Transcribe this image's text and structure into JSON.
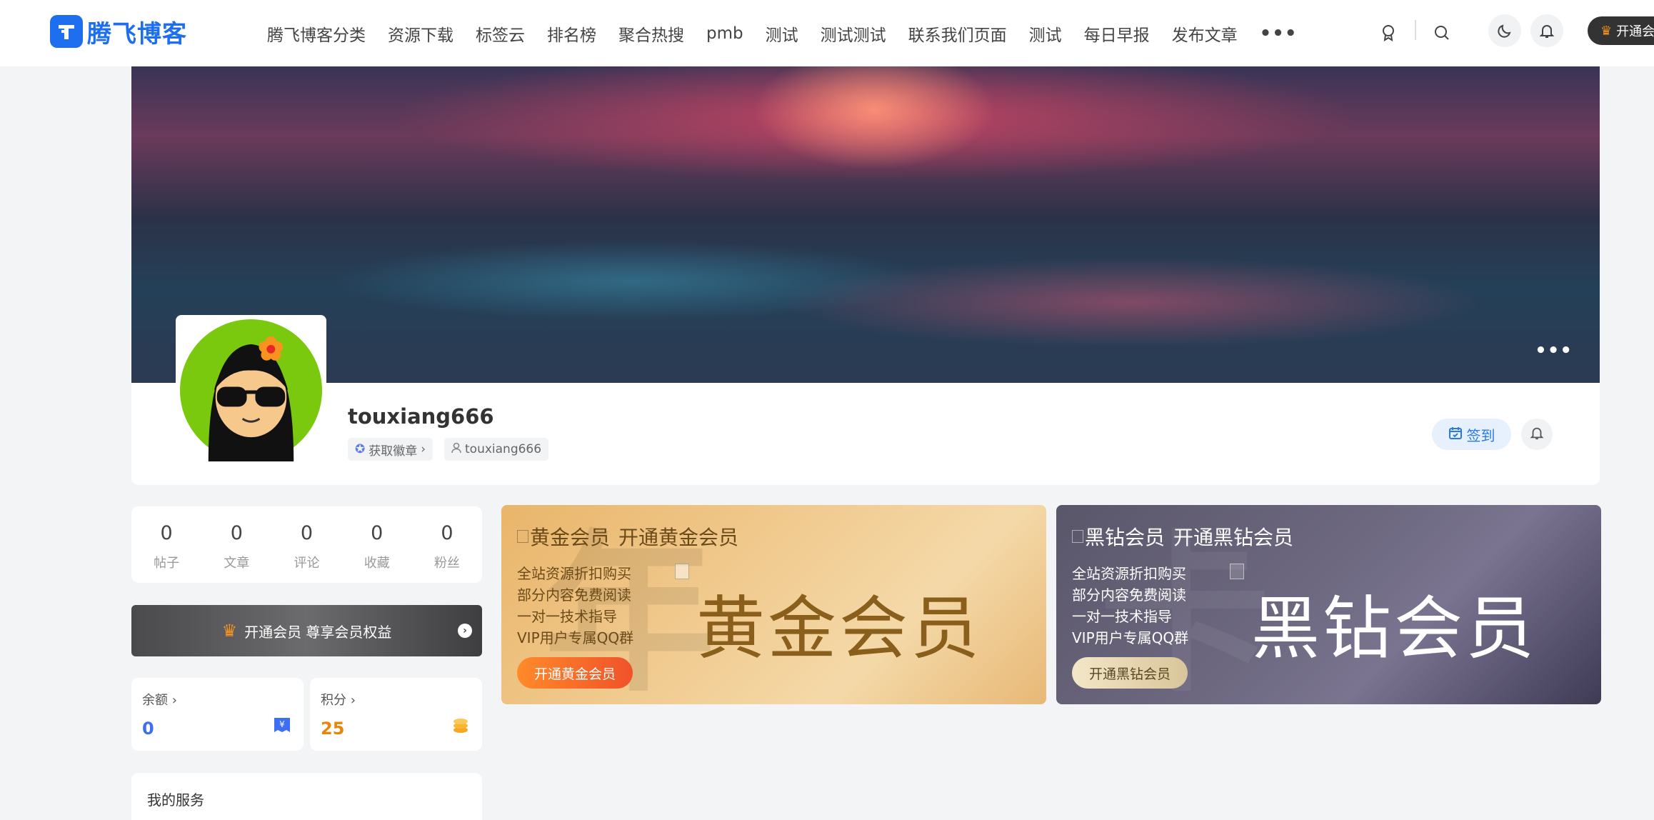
{
  "header": {
    "logo_text": "腾飞博客",
    "nav": [
      "腾飞博客分类",
      "资源下载",
      "标签云",
      "排名榜",
      "聚合热搜",
      "pmb",
      "测试",
      "测试测试",
      "联系我们页面",
      "测试",
      "每日早报",
      "发布文章"
    ],
    "more": "•••",
    "vip_button": "开通会",
    "icons": [
      "medal-icon",
      "search-icon",
      "moon-icon",
      "bell-icon",
      "crown-icon"
    ]
  },
  "cover": {
    "more": "•••"
  },
  "profile": {
    "username": "touxiang666",
    "badge_link": "获取徽章",
    "user_tag": "touxiang666",
    "sign_in": "签到"
  },
  "stats": [
    {
      "value": "0",
      "label": "帖子"
    },
    {
      "value": "0",
      "label": "文章"
    },
    {
      "value": "0",
      "label": "评论"
    },
    {
      "value": "0",
      "label": "收藏"
    },
    {
      "value": "0",
      "label": "粉丝"
    }
  ],
  "vip_bar": {
    "label": "开通会员 尊享会员权益"
  },
  "wallet": {
    "balance": {
      "title": "余额",
      "value": "0",
      "color": "#3d6ef5"
    },
    "points": {
      "title": "积分",
      "value": "25",
      "color": "#e8850c"
    }
  },
  "services": {
    "title": "我的服务"
  },
  "vip_cards": [
    {
      "alt": "黄金会员",
      "title": "开通黄金会员",
      "features": [
        "全站资源折扣购买",
        "部分内容免费阅读",
        "一对一技术指导",
        "VIP用户专属QQ群"
      ],
      "big_text": "黄金会员",
      "button": "开通黄金会员"
    },
    {
      "alt": "黑钻会员",
      "title": "开通黑钻会员",
      "features": [
        "全站资源折扣购买",
        "部分内容免费阅读",
        "一对一技术指导",
        "VIP用户专属QQ群"
      ],
      "big_text": "黑钻会员",
      "button": "开通黑钻会员"
    }
  ],
  "colors": {
    "brand": "#1e6ff0",
    "accent_blue": "#2a7ae4",
    "gold_button": "#f0522a"
  }
}
